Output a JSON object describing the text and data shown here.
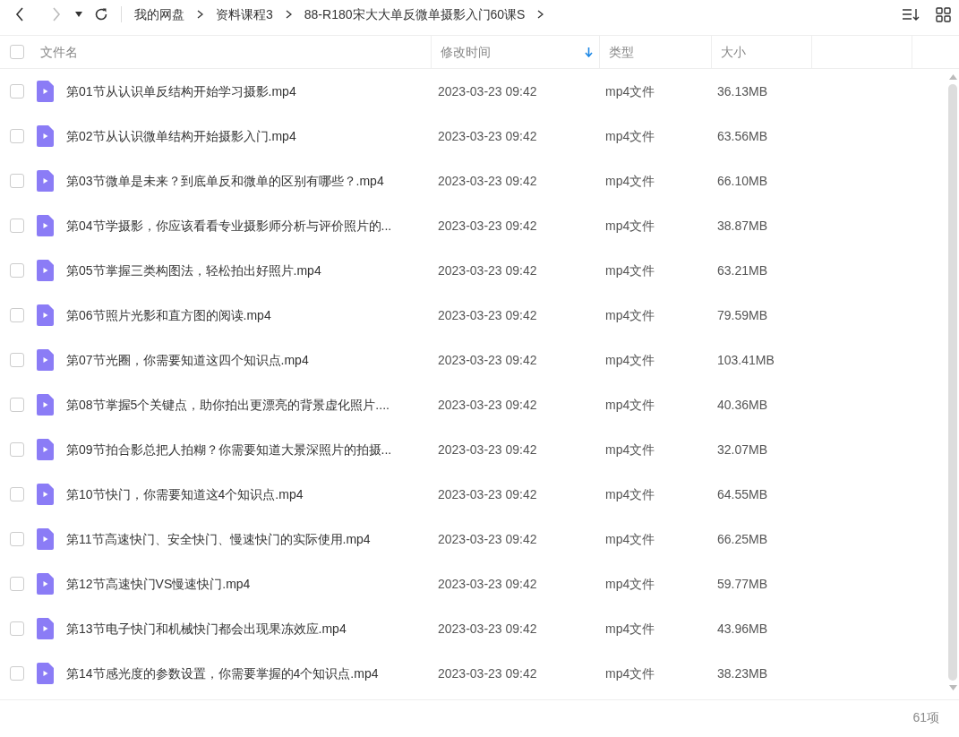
{
  "toolbar": {
    "breadcrumbs": [
      "我的网盘",
      "资料课程3",
      "88-R180宋大大单反微单摄影入门60课S"
    ]
  },
  "table": {
    "all_checked": false,
    "columns": [
      "文件名",
      "修改时间",
      "类型",
      "大小"
    ],
    "rows": [
      {
        "name": "第01节从认识单反结构开始学习摄影.mp4",
        "modified": "2023-03-23 09:42",
        "type": "mp4文件",
        "size": "36.13MB",
        "checked": false
      },
      {
        "name": "第02节从认识微单结构开始摄影入门.mp4",
        "modified": "2023-03-23 09:42",
        "type": "mp4文件",
        "size": "63.56MB",
        "checked": false
      },
      {
        "name": "第03节微单是未来？到底单反和微单的区别有哪些？.mp4",
        "modified": "2023-03-23 09:42",
        "type": "mp4文件",
        "size": "66.10MB",
        "checked": false
      },
      {
        "name": "第04节学摄影，你应该看看专业摄影师分析与评价照片的...",
        "modified": "2023-03-23 09:42",
        "type": "mp4文件",
        "size": "38.87MB",
        "checked": false
      },
      {
        "name": "第05节掌握三类构图法，轻松拍出好照片.mp4",
        "modified": "2023-03-23 09:42",
        "type": "mp4文件",
        "size": "63.21MB",
        "checked": false
      },
      {
        "name": "第06节照片光影和直方图的阅读.mp4",
        "modified": "2023-03-23 09:42",
        "type": "mp4文件",
        "size": "79.59MB",
        "checked": false
      },
      {
        "name": "第07节光圈，你需要知道这四个知识点.mp4",
        "modified": "2023-03-23 09:42",
        "type": "mp4文件",
        "size": "103.41MB",
        "checked": false
      },
      {
        "name": "第08节掌握5个关键点，助你拍出更漂亮的背景虚化照片....",
        "modified": "2023-03-23 09:42",
        "type": "mp4文件",
        "size": "40.36MB",
        "checked": false
      },
      {
        "name": "第09节拍合影总把人拍糊？你需要知道大景深照片的拍摄...",
        "modified": "2023-03-23 09:42",
        "type": "mp4文件",
        "size": "32.07MB",
        "checked": false
      },
      {
        "name": "第10节快门，你需要知道这4个知识点.mp4",
        "modified": "2023-03-23 09:42",
        "type": "mp4文件",
        "size": "64.55MB",
        "checked": false
      },
      {
        "name": "第11节高速快门、安全快门、慢速快门的实际使用.mp4",
        "modified": "2023-03-23 09:42",
        "type": "mp4文件",
        "size": "66.25MB",
        "checked": false
      },
      {
        "name": "第12节高速快门VS慢速快门.mp4",
        "modified": "2023-03-23 09:42",
        "type": "mp4文件",
        "size": "59.77MB",
        "checked": false
      },
      {
        "name": "第13节电子快门和机械快门都会出现果冻效应.mp4",
        "modified": "2023-03-23 09:42",
        "type": "mp4文件",
        "size": "43.96MB",
        "checked": false
      },
      {
        "name": "第14节感光度的参数设置，你需要掌握的4个知识点.mp4",
        "modified": "2023-03-23 09:42",
        "type": "mp4文件",
        "size": "38.23MB",
        "checked": false
      }
    ]
  },
  "status_bar": {
    "count": "61项"
  }
}
